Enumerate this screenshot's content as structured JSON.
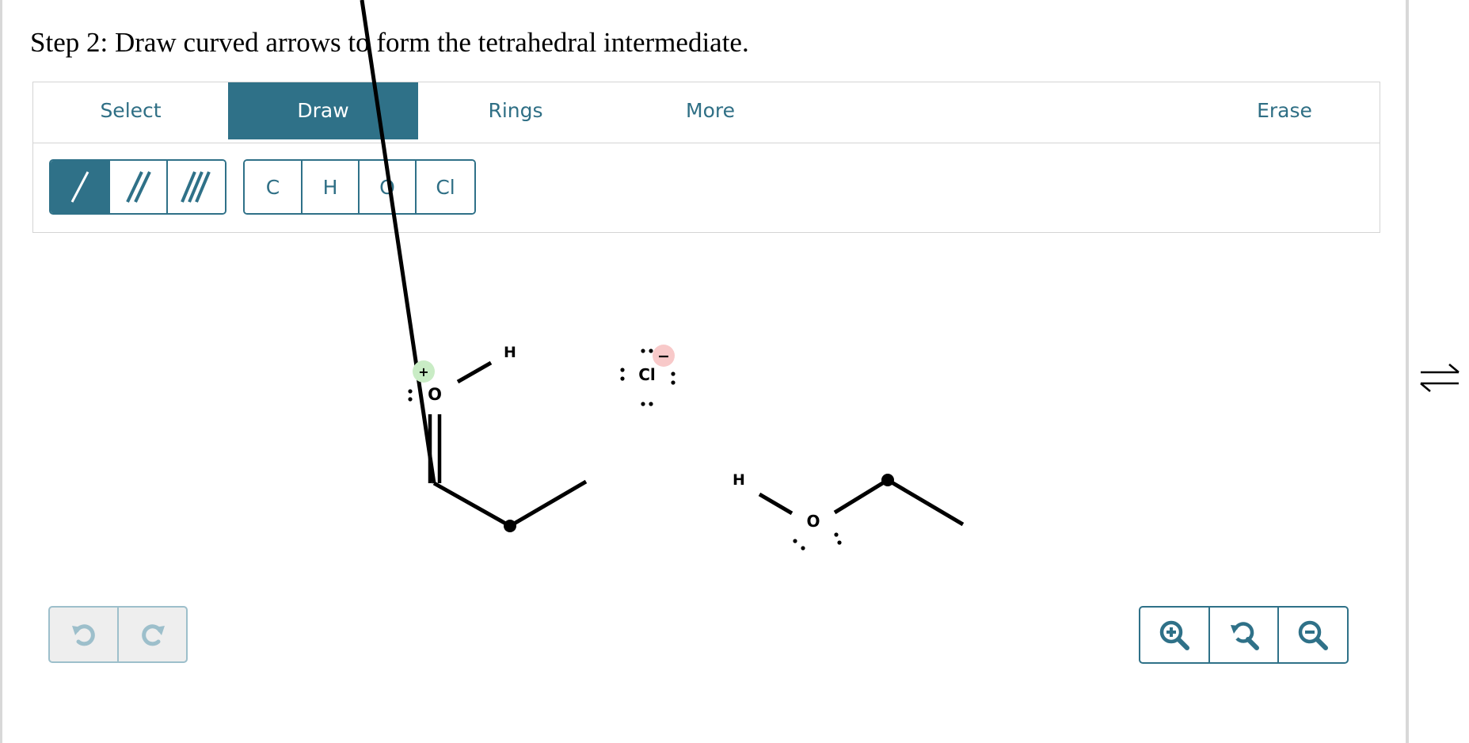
{
  "prompt": {
    "title": "Step 2: Draw curved arrows to form the tetrahedral intermediate."
  },
  "toolbar": {
    "tabs": [
      {
        "label": "Select",
        "active": false
      },
      {
        "label": "Draw",
        "active": true
      },
      {
        "label": "Rings",
        "active": false
      },
      {
        "label": "More",
        "active": false
      },
      {
        "label": "Erase",
        "active": false
      }
    ],
    "bond_tools": [
      {
        "name": "single-bond",
        "active": true
      },
      {
        "name": "double-bond",
        "active": false
      },
      {
        "name": "triple-bond",
        "active": false
      }
    ],
    "atoms": [
      "C",
      "H",
      "O",
      "Cl"
    ]
  },
  "molecules": {
    "oxonium": {
      "oxygen": "O",
      "hydrogen": "H",
      "charge": "+"
    },
    "chloride": {
      "atom": "Cl",
      "charge": "−"
    },
    "ethanol": {
      "hydrogen": "H",
      "oxygen": "O"
    }
  },
  "controls": {
    "history": [
      "undo-icon",
      "redo-icon"
    ],
    "zoom": [
      "zoom-in-icon",
      "zoom-reset-icon",
      "zoom-out-icon"
    ]
  },
  "colors": {
    "accent": "#2f7188",
    "positive_charge_bg": "#c9ecc5",
    "negative_charge_bg": "#f8c9c9"
  }
}
